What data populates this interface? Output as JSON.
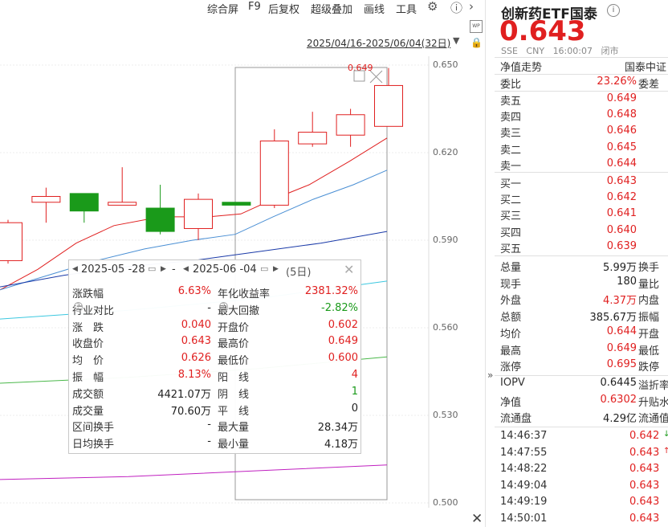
{
  "toolbar": {
    "items": [
      "综合屏",
      "F9",
      "后复权",
      "超级叠加",
      "画线",
      "工具"
    ],
    "date_range": "2025/04/16-2025/06/04(32日)",
    "wp_label": "WP"
  },
  "chart_data": {
    "type": "candlestick",
    "ylim": [
      0.5,
      0.65
    ],
    "y_ticks": [
      "0.650",
      "0.620",
      "0.590",
      "0.560",
      "0.530",
      "0.500"
    ],
    "max_label": "0.649",
    "candles": [
      {
        "open": 0.583,
        "close": 0.596,
        "high": 0.597,
        "low": 0.582
      },
      {
        "open": 0.603,
        "close": 0.605,
        "high": 0.608,
        "low": 0.596
      },
      {
        "open": 0.606,
        "close": 0.6,
        "high": 0.606,
        "low": 0.596
      },
      {
        "open": 0.602,
        "close": 0.603,
        "high": 0.615,
        "low": 0.602
      },
      {
        "open": 0.601,
        "close": 0.593,
        "high": 0.609,
        "low": 0.592
      },
      {
        "open": 0.594,
        "close": 0.604,
        "high": 0.606,
        "low": 0.59
      },
      {
        "open": 0.603,
        "close": 0.602,
        "high": 0.603,
        "low": 0.602
      },
      {
        "open": 0.602,
        "close": 0.624,
        "high": 0.628,
        "low": 0.601
      },
      {
        "open": 0.623,
        "close": 0.627,
        "high": 0.634,
        "low": 0.622
      },
      {
        "open": 0.626,
        "close": 0.633,
        "high": 0.635,
        "low": 0.622
      },
      {
        "open": 0.629,
        "close": 0.643,
        "high": 0.649,
        "low": 0.629
      }
    ],
    "colors": {
      "up": "#e02020",
      "down": "#1a9a1a",
      "ma_red": "#e02020",
      "ma_blue": "#4a8fd4",
      "ma_navy": "#1a3aa8",
      "ma_cyan": "#3cc8e0",
      "ma_green": "#4ab84a",
      "ma_purple": "#c020c0"
    }
  },
  "popup": {
    "start_date": "2025-05 -28",
    "end_date": "2025-06 -04",
    "days": "(5日)",
    "rows": [
      {
        "l1": "涨跌幅",
        "v1": "6.63%",
        "c1": "red",
        "q1": false,
        "l2": "年化收益率",
        "v2": "2381.32%",
        "c2": "red",
        "q2": false
      },
      {
        "l1": "行业对比",
        "v1": "-",
        "c1": "blk",
        "q1": true,
        "l2": "最大回撤",
        "v2": "-2.82%",
        "c2": "green",
        "q2": true
      },
      {
        "l1": "涨　跌",
        "v1": "0.040",
        "c1": "red",
        "q1": false,
        "l2": "开盘价",
        "v2": "0.602",
        "c2": "red",
        "q2": false
      },
      {
        "l1": "收盘价",
        "v1": "0.643",
        "c1": "red",
        "q1": false,
        "l2": "最高价",
        "v2": "0.649",
        "c2": "red",
        "q2": false
      },
      {
        "l1": "均　价",
        "v1": "0.626",
        "c1": "red",
        "q1": false,
        "l2": "最低价",
        "v2": "0.600",
        "c2": "red",
        "q2": false
      },
      {
        "l1": "振　幅",
        "v1": "8.13%",
        "c1": "red",
        "q1": false,
        "l2": "阳　线",
        "v2": "4",
        "c2": "red",
        "q2": false
      },
      {
        "l1": "成交额",
        "v1": "4421.07万",
        "c1": "blk",
        "q1": false,
        "l2": "阴　线",
        "v2": "1",
        "c2": "green",
        "q2": false
      },
      {
        "l1": "成交量",
        "v1": "70.60万",
        "c1": "blk",
        "q1": false,
        "l2": "平　线",
        "v2": "0",
        "c2": "blk",
        "q2": false
      },
      {
        "l1": "区间换手",
        "v1": "-",
        "c1": "blk",
        "q1": false,
        "l2": "最大量",
        "v2": "28.34万",
        "c2": "blk",
        "q2": false
      },
      {
        "l1": "日均换手",
        "v1": "-",
        "c1": "blk",
        "q1": false,
        "l2": "最小量",
        "v2": "4.18万",
        "c2": "blk",
        "q2": false
      }
    ]
  },
  "quote": {
    "name": "创新药ETF国泰",
    "price": "0.643",
    "exchange": "SSE",
    "currency": "CNY",
    "time": "16:00:07",
    "status": "闭市",
    "nav_label": "净值走势",
    "nav_source": "国泰中证",
    "wb_label": "委比",
    "wb_value": "23.26%",
    "wc_label": "委差",
    "asks": [
      {
        "label": "卖五",
        "price": "0.649"
      },
      {
        "label": "卖四",
        "price": "0.648"
      },
      {
        "label": "卖三",
        "price": "0.646"
      },
      {
        "label": "卖二",
        "price": "0.645"
      },
      {
        "label": "卖一",
        "price": "0.644"
      }
    ],
    "bids": [
      {
        "label": "买一",
        "price": "0.643"
      },
      {
        "label": "买二",
        "price": "0.642"
      },
      {
        "label": "买三",
        "price": "0.641"
      },
      {
        "label": "买四",
        "price": "0.640"
      },
      {
        "label": "买五",
        "price": "0.639"
      }
    ],
    "stats": [
      {
        "l": "总量",
        "v": "5.99万",
        "c": "blk",
        "x": "换手"
      },
      {
        "l": "现手",
        "v": "180",
        "c": "blk",
        "x": "量比"
      },
      {
        "l": "外盘",
        "v": "4.37万",
        "c": "red",
        "x": "内盘"
      },
      {
        "l": "总额",
        "v": "385.67万",
        "c": "blk",
        "x": "振幅"
      },
      {
        "l": "均价",
        "v": "0.644",
        "c": "red",
        "x": "开盘"
      },
      {
        "l": "最高",
        "v": "0.649",
        "c": "red",
        "x": "最低"
      },
      {
        "l": "涨停",
        "v": "0.695",
        "c": "red",
        "x": "跌停"
      }
    ],
    "extra": [
      {
        "l": "IOPV",
        "v": "0.6445",
        "c": "blk",
        "x": "溢折率"
      },
      {
        "l": "净值",
        "v": "0.6302",
        "c": "red",
        "x": "升贴水"
      },
      {
        "l": "流通盘",
        "v": "4.29亿",
        "c": "blk",
        "x": "流通值"
      }
    ],
    "ticks": [
      {
        "time": "14:46:37",
        "price": "0.642",
        "arrow": "↓",
        "ac": "green"
      },
      {
        "time": "14:47:55",
        "price": "0.643",
        "arrow": "↑",
        "ac": "red"
      },
      {
        "time": "14:48:22",
        "price": "0.643",
        "arrow": "",
        "ac": "red"
      },
      {
        "time": "14:49:04",
        "price": "0.643",
        "arrow": "",
        "ac": "red"
      },
      {
        "time": "14:49:19",
        "price": "0.643",
        "arrow": "",
        "ac": "red"
      },
      {
        "time": "14:50:01",
        "price": "0.643",
        "arrow": "",
        "ac": "red"
      }
    ]
  }
}
